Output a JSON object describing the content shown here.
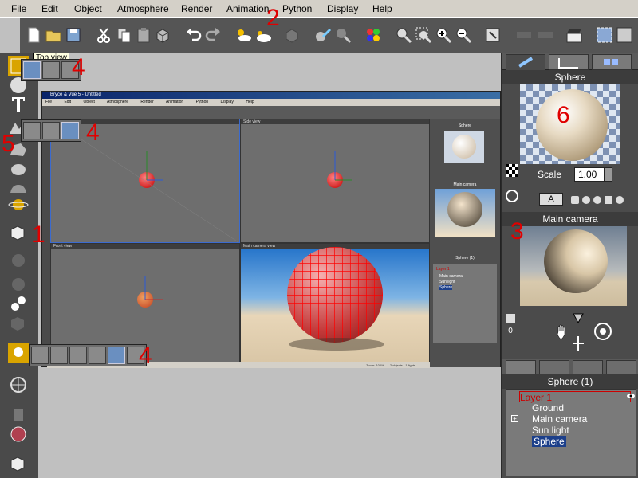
{
  "menu": {
    "items": [
      "File",
      "Edit",
      "Object",
      "Atmosphere",
      "Render",
      "Animation",
      "Python",
      "Display",
      "Help"
    ]
  },
  "annotations": [
    "1",
    "2",
    "3",
    "4",
    "4",
    "4",
    "5",
    "6"
  ],
  "tooltip": "Top view",
  "embedded_window": {
    "title": "Bryce & Vue 5 - Untitled",
    "menu": [
      "File",
      "Edit",
      "Object",
      "Atmosphere",
      "Render",
      "Animation",
      "Python",
      "Display",
      "Help"
    ],
    "viewports": [
      "Top view",
      "Side view",
      "Front view",
      "Main camera view"
    ],
    "right_labels": {
      "preview": "Sphere",
      "camera": "Main camera",
      "scene": "Sphere (1)"
    },
    "scene_items": [
      "Layer 1",
      "Main camera",
      "Sun light",
      "Sphere"
    ],
    "status": "2 objects · 1 lights",
    "zoom": "Zoom: 100%"
  },
  "right_panel": {
    "object_name": "Sphere",
    "scale_label": "Scale",
    "scale_value": "1.00",
    "camera_name": "Main camera",
    "scene_title": "Sphere (1)",
    "preview_mode": "A",
    "frame_counter": "0",
    "tree": [
      {
        "label": "Layer 1",
        "color": "#cc0000"
      },
      {
        "label": "Ground",
        "color": "#ffffff"
      },
      {
        "label": "Main camera",
        "color": "#ffffff"
      },
      {
        "label": "Sun light",
        "color": "#ffffff"
      },
      {
        "label": "Sphere",
        "color": "#ffffff"
      }
    ]
  },
  "colors": {
    "annotation": "#e00000",
    "toolbar": "#555555",
    "panel": "#4b4b4b",
    "selection": "#1c3f8a"
  }
}
